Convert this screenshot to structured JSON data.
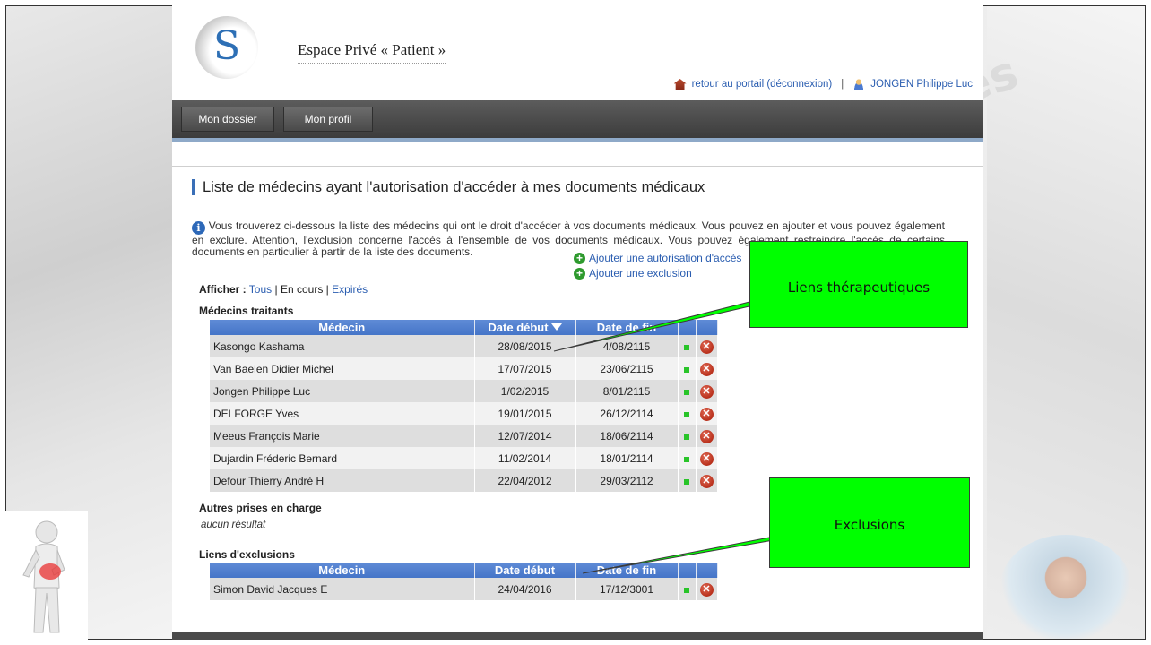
{
  "header": {
    "logo_letter": "S",
    "site_title": "Espace Privé « Patient »",
    "logout_link": "retour au portail (déconnexion)",
    "separator": "|",
    "user_name": "JONGEN Philippe Luc"
  },
  "nav": {
    "tabs": [
      {
        "label": "Mon dossier"
      },
      {
        "label": "Mon profil"
      }
    ]
  },
  "main": {
    "page_title": "Liste de médecins ayant l'autorisation d'accéder à mes documents médicaux",
    "info_text": "Vous trouverez ci-dessous la liste des médecins qui ont le droit d'accéder à vos documents médicaux. Vous pouvez en ajouter et vous pouvez également en exclure. Attention, l'exclusion concerne l'accès à l'ensemble de vos documents médicaux. Vous pouvez également restreindre l'accès de certains documents en particulier à partir de la liste des documents.",
    "actions": {
      "add_authorization": "Ajouter une autorisation d'accès",
      "add_exclusion": "Ajouter une exclusion"
    },
    "filter": {
      "label": "Afficher :",
      "all": "Tous",
      "sep1": "|",
      "current": "En cours",
      "sep2": "|",
      "expired": "Expirés"
    },
    "treating": {
      "section_title": "Médecins traitants",
      "columns": [
        "Médecin",
        "Date début",
        "Date de fin"
      ],
      "rows": [
        {
          "name": "Kasongo Kashama",
          "start": "28/08/2015",
          "end": "4/08/2115"
        },
        {
          "name": "Van Baelen Didier Michel",
          "start": "17/07/2015",
          "end": "23/06/2115"
        },
        {
          "name": "Jongen Philippe Luc",
          "start": "1/02/2015",
          "end": "8/01/2115"
        },
        {
          "name": "DELFORGE Yves",
          "start": "19/01/2015",
          "end": "26/12/2114"
        },
        {
          "name": "Meeus François Marie",
          "start": "12/07/2014",
          "end": "18/06/2114"
        },
        {
          "name": "Dujardin Fréderic Bernard",
          "start": "11/02/2014",
          "end": "18/01/2114"
        },
        {
          "name": "Defour Thierry André H",
          "start": "22/04/2012",
          "end": "29/03/2112"
        }
      ]
    },
    "other": {
      "section_title": "Autres prises en charge",
      "empty_text": "aucun résultat"
    },
    "exclusions": {
      "section_title": "Liens d'exclusions",
      "columns": [
        "Médecin",
        "Date début",
        "Date de fin"
      ],
      "rows": [
        {
          "name": "Simon David Jacques E",
          "start": "24/04/2016",
          "end": "17/12/3001"
        }
      ]
    }
  },
  "callouts": {
    "therapeutic": "Liens thérapeutiques",
    "exclusions": "Exclusions"
  },
  "watermark": "rvés",
  "colors": {
    "callout": "#00ff00",
    "table_header": "#4f7ecf",
    "link": "#2a5db0",
    "status_ok": "#29c429",
    "delete": "#c0392b"
  }
}
